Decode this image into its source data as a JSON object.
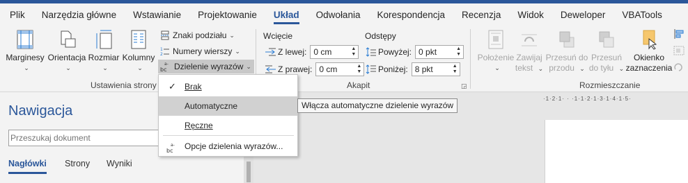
{
  "tabs": [
    "Plik",
    "Narzędzia główne",
    "Wstawianie",
    "Projektowanie",
    "Układ",
    "Odwołania",
    "Korespondencja",
    "Recenzja",
    "Widok",
    "Deweloper",
    "VBATools"
  ],
  "ribbon": {
    "page_setup": {
      "margins": "Marginesy",
      "orientation": "Orientacja",
      "size": "Rozmiar",
      "columns": "Kolumny",
      "breaks": "Znaki podziału",
      "line_numbers": "Numery wierszy",
      "hyphenation": "Dzielenie wyrazów",
      "label": "Ustawienia strony"
    },
    "paragraph": {
      "indent_title": "Wcięcie",
      "spacing_title": "Odstępy",
      "left_label": "Z lewej:",
      "left_value": "0 cm",
      "right_label": "Z prawej:",
      "right_value": "0 cm",
      "before_label": "Powyżej:",
      "before_value": "0 pkt",
      "after_label": "Poniżej:",
      "after_value": "8 pkt",
      "label": "Akapit"
    },
    "arrange": {
      "position_line1": "Położenie",
      "wrap_line1": "Zawijaj",
      "wrap_line2": "tekst",
      "forward_line1": "Przesuń do",
      "forward_line2": "przodu",
      "backward_line1": "Przesuń",
      "backward_line2": "do tyłu",
      "selection_line1": "Okienko",
      "selection_line2": "zaznaczenia",
      "label": "Rozmieszczanie"
    }
  },
  "navigation": {
    "title": "Nawigacja",
    "search_placeholder": "Przeszukaj dokument",
    "tabs": [
      "Nagłówki",
      "Strony",
      "Wyniki"
    ]
  },
  "ruler_text": "·1·2·1· · ·1·1·2·1·3·1·4·1·5·",
  "menu": {
    "none": "Brak",
    "auto": "Automatyczne",
    "manual": "Ręczne",
    "options": "Opcje dzielenia wyrazów..."
  },
  "tooltip": "Włącza automatyczne dzielenie wyrazów",
  "colors": {
    "accent": "#2b579a",
    "ribbon_bg": "#f3f3f3",
    "menu_hover": "#d1d1d1"
  }
}
